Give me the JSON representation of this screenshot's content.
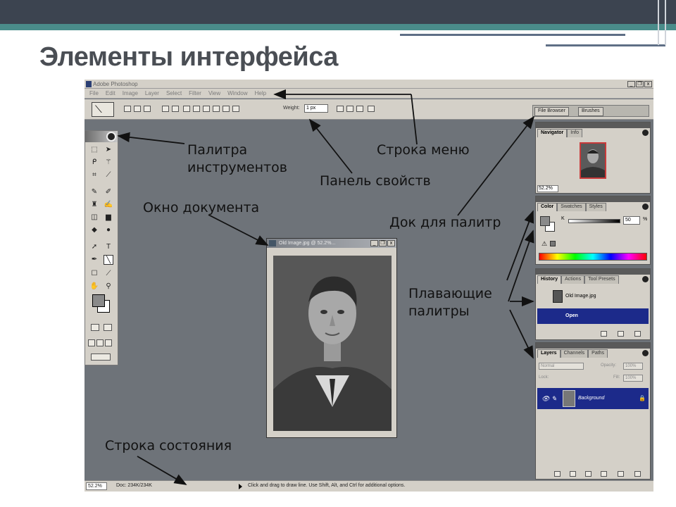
{
  "slide": {
    "title": "Элементы интерфейса"
  },
  "app": {
    "window_title": "Adobe Photoshop",
    "window_buttons": [
      "_",
      "❐",
      "x"
    ],
    "menu": [
      "File",
      "Edit",
      "Image",
      "Layer",
      "Select",
      "Filter",
      "View",
      "Window",
      "Help"
    ],
    "options_bar": {
      "weight_label": "Weight:",
      "weight_value": "1 px"
    },
    "palette_well_tabs": [
      "File Browser",
      "Brushes"
    ],
    "document": {
      "title": "Old Image.jpg @ 52.2%...",
      "buttons": [
        "_",
        "❐",
        "x"
      ]
    },
    "palettes": {
      "navigator": {
        "tabs": [
          "Navigator",
          "Info"
        ],
        "zoom": "52.2%"
      },
      "color": {
        "tabs": [
          "Color",
          "Swatches",
          "Styles"
        ],
        "channel": "K",
        "value": "50",
        "unit": "%"
      },
      "history": {
        "tabs": [
          "History",
          "Actions",
          "Tool Presets"
        ],
        "items": [
          "Old Image.jpg",
          "Open"
        ]
      },
      "layers": {
        "tabs": [
          "Layers",
          "Channels",
          "Paths"
        ],
        "blend_mode": "Normal",
        "opacity_label": "Opacity:",
        "opacity_value": "100%",
        "lock_label": "Lock:",
        "fill_label": "Fill:",
        "fill_value": "100%",
        "layer_name": "Background"
      }
    },
    "status_bar": {
      "zoom": "52.2%",
      "doc_size": "Doc: 234K/234K",
      "hint": "Click and drag to draw line. Use Shift, Alt, and Ctrl for additional options."
    }
  },
  "annotations": {
    "toolbox_line1": "Палитра",
    "toolbox_line2": "инструментов",
    "menu_bar": "Строка меню",
    "options_bar": "Панель свойств",
    "document_window": "Окно документа",
    "palette_dock": "Док для палитр",
    "floating_line1": "Плавающие",
    "floating_line2": "палитры",
    "status_bar": "Строка состояния"
  },
  "colors": {
    "top_band": "#3c4450",
    "teal_band": "#4a8c8a",
    "workspace": "#6e7379",
    "chrome": "#d4d0c8",
    "selection": "#1c2a8a"
  }
}
